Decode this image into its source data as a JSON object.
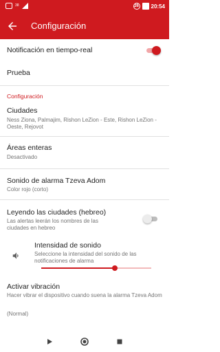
{
  "status_bar": {
    "left_badge": "26",
    "left_mini": "38",
    "right_icon": "26",
    "time": "20:54"
  },
  "app_bar": {
    "title": "Configuración"
  },
  "settings": {
    "notification_realtime": {
      "title": "Notificación en tiempo-real",
      "enabled": true
    },
    "test": {
      "title": "Prueba"
    },
    "category": "Configuración",
    "cities": {
      "title": "Ciudades",
      "summary": "Ness Ziona, Palmajim, Rishon LeZion - Este, Rishon LeZion - Oeste, Rejovot"
    },
    "areas": {
      "title": "Áreas enteras",
      "summary": "Desactivado"
    },
    "alarm_sound": {
      "title": "Sonido de alarma Tzeva Adom",
      "summary": "Color rojo (corto)"
    },
    "read_cities": {
      "title": "Leyendo las ciudades (hebreo)",
      "summary": "Las alertas leerán los nombres de las ciudades en hebreo",
      "enabled": false
    },
    "sound_intensity": {
      "title": "Intensidad de sonido",
      "summary": "Seleccione la intensidad del sonido de las notificaciones de alarma",
      "value_fraction": 0.67
    },
    "vibration": {
      "title": "Activar vibración",
      "summary": "Hacer vibrar el dispositivo cuando suena la alarma Tzeva Adom",
      "value": "(Normal)"
    }
  },
  "colors": {
    "accent": "#cf1a1f",
    "toggle_off_thumb": "#ececec",
    "toggle_off_track": "#bdbdbd"
  },
  "icons": {
    "back": "arrow-left-icon",
    "volume": "volume-icon",
    "nav_back": "triangle-back-icon",
    "nav_home": "circle-home-icon",
    "nav_recents": "square-recents-icon"
  }
}
